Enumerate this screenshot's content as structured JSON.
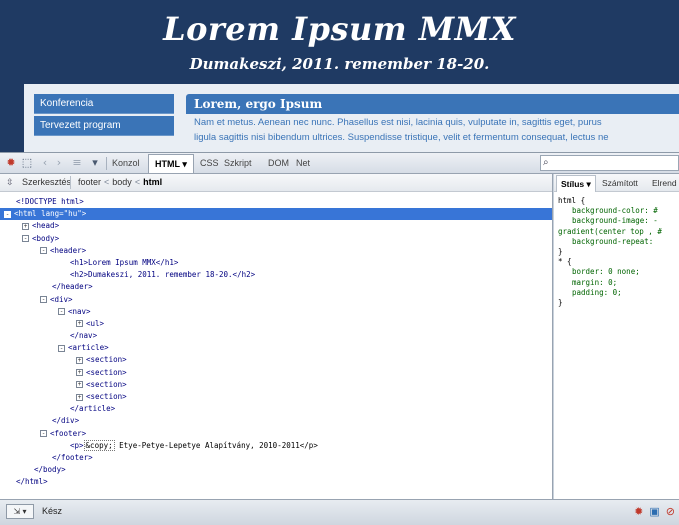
{
  "page": {
    "h1": "Lorem Ipsum MMX",
    "h2": "Dumakeszi, 2011. remember 18-20.",
    "nav": [
      "Konferencia",
      "Tervezett program"
    ],
    "article_title": "Lorem, ergo Ipsum",
    "article_lines": [
      "Nam et metus. Aenean nec nunc. Phasellus est nisi, lacinia quis, vulputate in, sagittis eget, purus",
      "ligula sagittis nisi bibendum ultrices. Suspendisse tristique, velit et fermentum consequat, lectus ne"
    ]
  },
  "toolbar": {
    "tabs": [
      "Konzol",
      "HTML ▾",
      "CSS",
      "Szkript",
      "DOM",
      "Net"
    ],
    "active_tab": "HTML ▾"
  },
  "breadcrumb": {
    "edit_label": "Szerkesztés",
    "trail": [
      "footer",
      "body"
    ],
    "current": "html"
  },
  "html_tree": [
    {
      "text": "<!DOCTYPE html>",
      "style": "gray",
      "indent": 0,
      "toggle": ""
    },
    {
      "text": "<html lang=\"hu\">",
      "style": "sel",
      "indent": 0,
      "toggle": "-"
    },
    {
      "text": "<head>",
      "style": "",
      "indent": 1,
      "toggle": "+"
    },
    {
      "text": "<body>",
      "style": "",
      "indent": 1,
      "toggle": "-"
    },
    {
      "text": "<header>",
      "style": "",
      "indent": 2,
      "toggle": "-"
    },
    {
      "text": "<h1>Lorem Ipsum MMX</h1>",
      "style": "",
      "indent": 3,
      "toggle": ""
    },
    {
      "text": "<h2>Dumakeszi, 2011. remember 18-20.</h2>",
      "style": "",
      "indent": 3,
      "toggle": ""
    },
    {
      "text": "</header>",
      "style": "",
      "indent": 2,
      "toggle": ""
    },
    {
      "text": "<div>",
      "style": "",
      "indent": 2,
      "toggle": "-"
    },
    {
      "text": "<nav>",
      "style": "",
      "indent": 3,
      "toggle": "-"
    },
    {
      "text": "<ul>",
      "style": "",
      "indent": 4,
      "toggle": "+"
    },
    {
      "text": "</nav>",
      "style": "",
      "indent": 3,
      "toggle": ""
    },
    {
      "text": "<article>",
      "style": "",
      "indent": 3,
      "toggle": "-"
    },
    {
      "text": "<section>",
      "style": "",
      "indent": 4,
      "toggle": "+"
    },
    {
      "text": "<section>",
      "style": "",
      "indent": 4,
      "toggle": "+"
    },
    {
      "text": "<section>",
      "style": "",
      "indent": 4,
      "toggle": "+"
    },
    {
      "text": "<section>",
      "style": "",
      "indent": 4,
      "toggle": "+"
    },
    {
      "text": "</article>",
      "style": "",
      "indent": 3,
      "toggle": ""
    },
    {
      "text": "</div>",
      "style": "",
      "indent": 2,
      "toggle": ""
    },
    {
      "text": "<footer>",
      "style": "",
      "indent": 2,
      "toggle": "-"
    },
    {
      "text": "<p>",
      "style": "",
      "indent": 3,
      "toggle": "",
      "entity": "&copy;",
      "after": " Etye-Petye-Lepetye Alapítvány, 2010-2011</p>"
    },
    {
      "text": "</footer>",
      "style": "",
      "indent": 2,
      "toggle": ""
    },
    {
      "text": "</body>",
      "style": "",
      "indent": 1,
      "toggle": ""
    },
    {
      "text": "</html>",
      "style": "",
      "indent": 0,
      "toggle": ""
    }
  ],
  "side": {
    "tabs": [
      "Stílus ▾",
      "Számított",
      "Elrend"
    ],
    "active_tab": "Stílus ▾",
    "css_lines": [
      {
        "text": "html {",
        "kind": "sel"
      },
      {
        "text": "background-color: #",
        "kind": "prop"
      },
      {
        "text": "background-image: -",
        "kind": "prop"
      },
      {
        "text": "gradient(center top , #",
        "kind": "cont"
      },
      {
        "text": "background-repeat: ",
        "kind": "prop"
      },
      {
        "text": "}",
        "kind": "brace"
      },
      {
        "text": "* {",
        "kind": "sel"
      },
      {
        "text": "border: 0 none;",
        "kind": "prop"
      },
      {
        "text": "margin: 0;",
        "kind": "prop"
      },
      {
        "text": "padding: 0;",
        "kind": "prop"
      },
      {
        "text": "}",
        "kind": "brace"
      }
    ]
  },
  "status": {
    "text": "Kész"
  },
  "colors": {
    "header_bg": "#1f3a63",
    "nav_blue": "#3a74b7",
    "selection": "#3875d7"
  }
}
